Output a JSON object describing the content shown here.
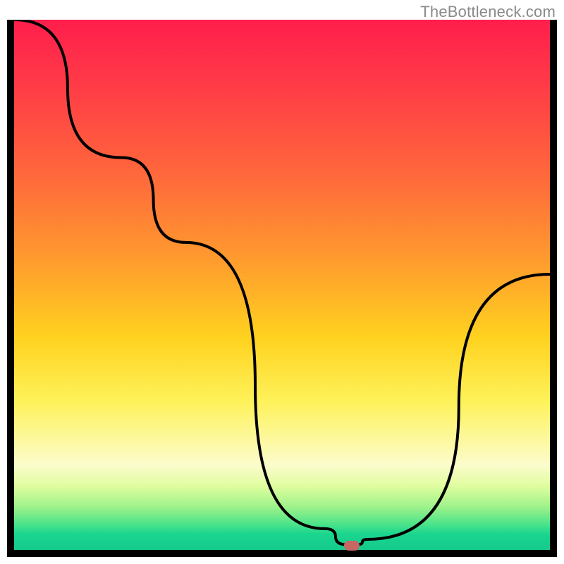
{
  "attribution": "TheBottleneck.com",
  "chart_data": {
    "type": "line",
    "title": "",
    "xlabel": "",
    "ylabel": "",
    "xlim": [
      0,
      100
    ],
    "ylim": [
      0,
      100
    ],
    "grid": false,
    "legend": false,
    "x": [
      0,
      20,
      32,
      58,
      62,
      64,
      66,
      100
    ],
    "values": [
      100,
      74,
      58,
      4,
      1,
      1,
      2,
      52
    ],
    "marker": {
      "x": 63,
      "y": 0.8
    },
    "gradient_stops": [
      {
        "pos": 0,
        "color": "#ff1e4c"
      },
      {
        "pos": 30,
        "color": "#ff6a3b"
      },
      {
        "pos": 60,
        "color": "#ffd21f"
      },
      {
        "pos": 84,
        "color": "#fcfccc"
      },
      {
        "pos": 100,
        "color": "#14c98c"
      }
    ]
  }
}
